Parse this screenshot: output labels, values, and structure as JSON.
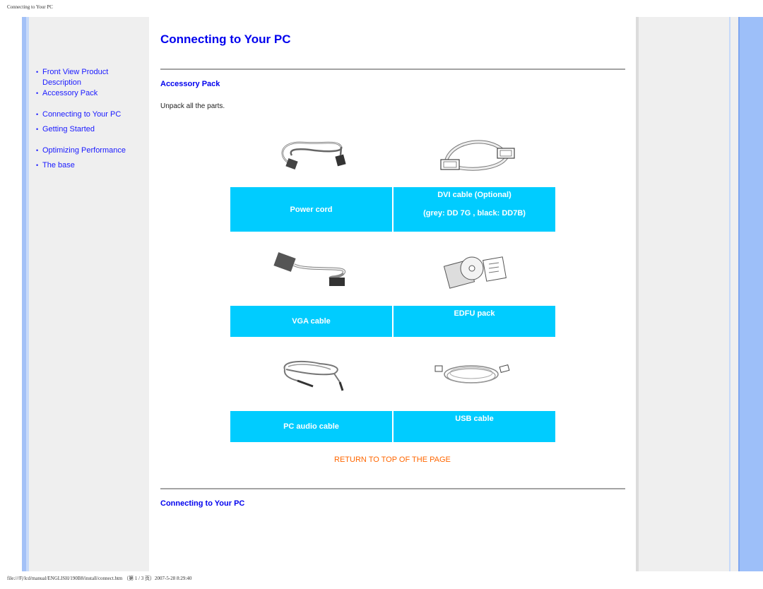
{
  "page_header": "Connecting to Your PC",
  "sidebar": {
    "items": [
      {
        "label": "Front View Product Description"
      },
      {
        "label": "Accessory Pack"
      },
      {
        "label": "Connecting to Your PC"
      },
      {
        "label": "Getting Started"
      },
      {
        "label": "Optimizing Performance"
      },
      {
        "label": "The base"
      }
    ]
  },
  "main": {
    "title": "Connecting to Your PC",
    "section_accessory": "Accessory Pack",
    "intro": "Unpack all the parts.",
    "items": [
      {
        "label": "Power cord",
        "image": "power-cord-image"
      },
      {
        "label": "DVI cable (Optional)",
        "sublabel": "(grey: DD 7G , black: DD7B)",
        "image": "dvi-cable-image"
      },
      {
        "label": "VGA cable",
        "image": "vga-cable-image"
      },
      {
        "label": "EDFU pack",
        "image": "edfu-pack-image"
      },
      {
        "label": "PC audio cable",
        "image": "audio-cable-image"
      },
      {
        "label": "USB cable",
        "image": "usb-cable-image"
      }
    ],
    "return_link": "RETURN TO TOP OF THE PAGE",
    "section_connecting": "Connecting to Your PC"
  },
  "footer_path": "file:///F|/lcd/manual/ENGLISH/190B8/install/connect.htm （第 1 / 3 页）2007-5-28 8:29:40",
  "colors": {
    "link": "#0000ee",
    "label_bg": "#00ccff",
    "return_link": "#ff6600",
    "sidebar_bg": "#efefef",
    "accent_blue": "#9dbff9"
  }
}
